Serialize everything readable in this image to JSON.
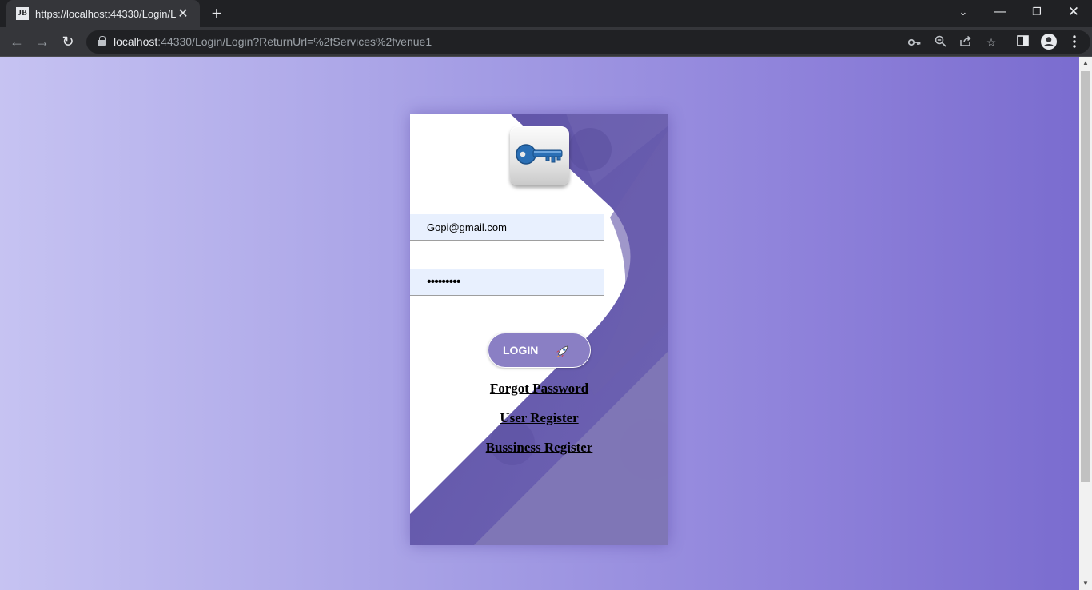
{
  "browser": {
    "tab_title": "https://localhost:44330/Login/Login?ReturnUrl=%2fServices%2fvenue1",
    "favicon_text": "JB",
    "new_tab_label": "+",
    "url_host": "localhost",
    "url_path": ":44330/Login/Login?ReturnUrl=%2fServices%2fvenue1",
    "icons": [
      "back-arrow",
      "forward-arrow",
      "reload",
      "lock",
      "key",
      "zoom-out",
      "share",
      "star",
      "side-panel",
      "profile",
      "menu-dots"
    ]
  },
  "login": {
    "email_value": "Gopi@gmail.com",
    "password_value": "•••••••••",
    "button_label": "LOGIN",
    "forgot_password": "Forgot Password",
    "user_register": "User Register",
    "business_register": "Bussiness Register"
  },
  "colors": {
    "background_left": "#c6c3f2",
    "background_right": "#7a6ccf",
    "card_purple": "#6255a8",
    "field_fill": "#e8f0fe",
    "button_fill": "#8a7fc4"
  }
}
